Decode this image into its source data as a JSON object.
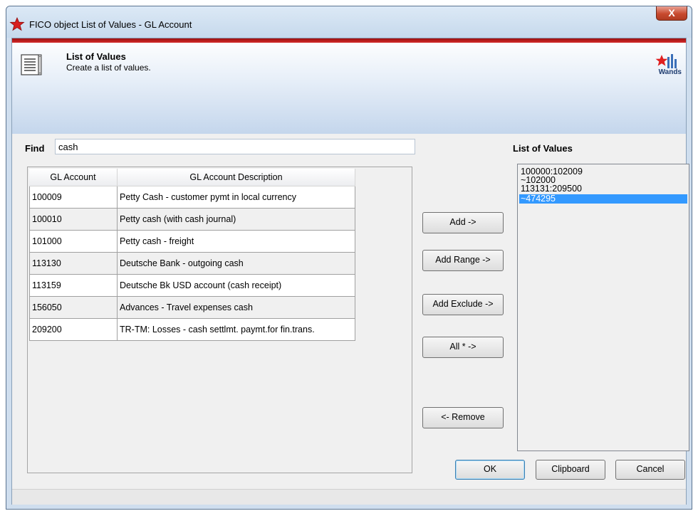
{
  "window": {
    "title": "FICO object List of Values - GL Account",
    "close_label": "X"
  },
  "header": {
    "title": "List of Values",
    "subtitle": "Create a list of values.",
    "logo_text": "Wands"
  },
  "find": {
    "label": "Find",
    "value": "cash"
  },
  "grid": {
    "columns": [
      "GL Account",
      "GL Account Description"
    ],
    "rows": [
      {
        "account": "100009",
        "description": "Petty Cash - customer pymt in local currency"
      },
      {
        "account": "100010",
        "description": "Petty cash (with cash journal)"
      },
      {
        "account": "101000",
        "description": "Petty cash - freight"
      },
      {
        "account": "113130",
        "description": "Deutsche Bank - outgoing cash"
      },
      {
        "account": "113159",
        "description": "Deutsche Bk USD account (cash receipt)"
      },
      {
        "account": "156050",
        "description": "Advances - Travel expenses cash"
      },
      {
        "account": "209200",
        "description": "TR-TM: Losses - cash settlmt. paymt.for fin.trans."
      }
    ]
  },
  "actions": {
    "add": "Add ->",
    "add_range": "Add Range ->",
    "add_exclude": "Add Exclude ->",
    "all": "All * ->",
    "remove": "<- Remove"
  },
  "list_of_values": {
    "title": "List of Values",
    "items": [
      "100000:102009",
      "~102000",
      "113131:209500",
      "~474295"
    ],
    "selected_index": 3
  },
  "footer": {
    "ok": "OK",
    "clipboard": "Clipboard",
    "cancel": "Cancel"
  },
  "colors": {
    "selection": "#3399ff",
    "header_accent": "#c62020"
  }
}
